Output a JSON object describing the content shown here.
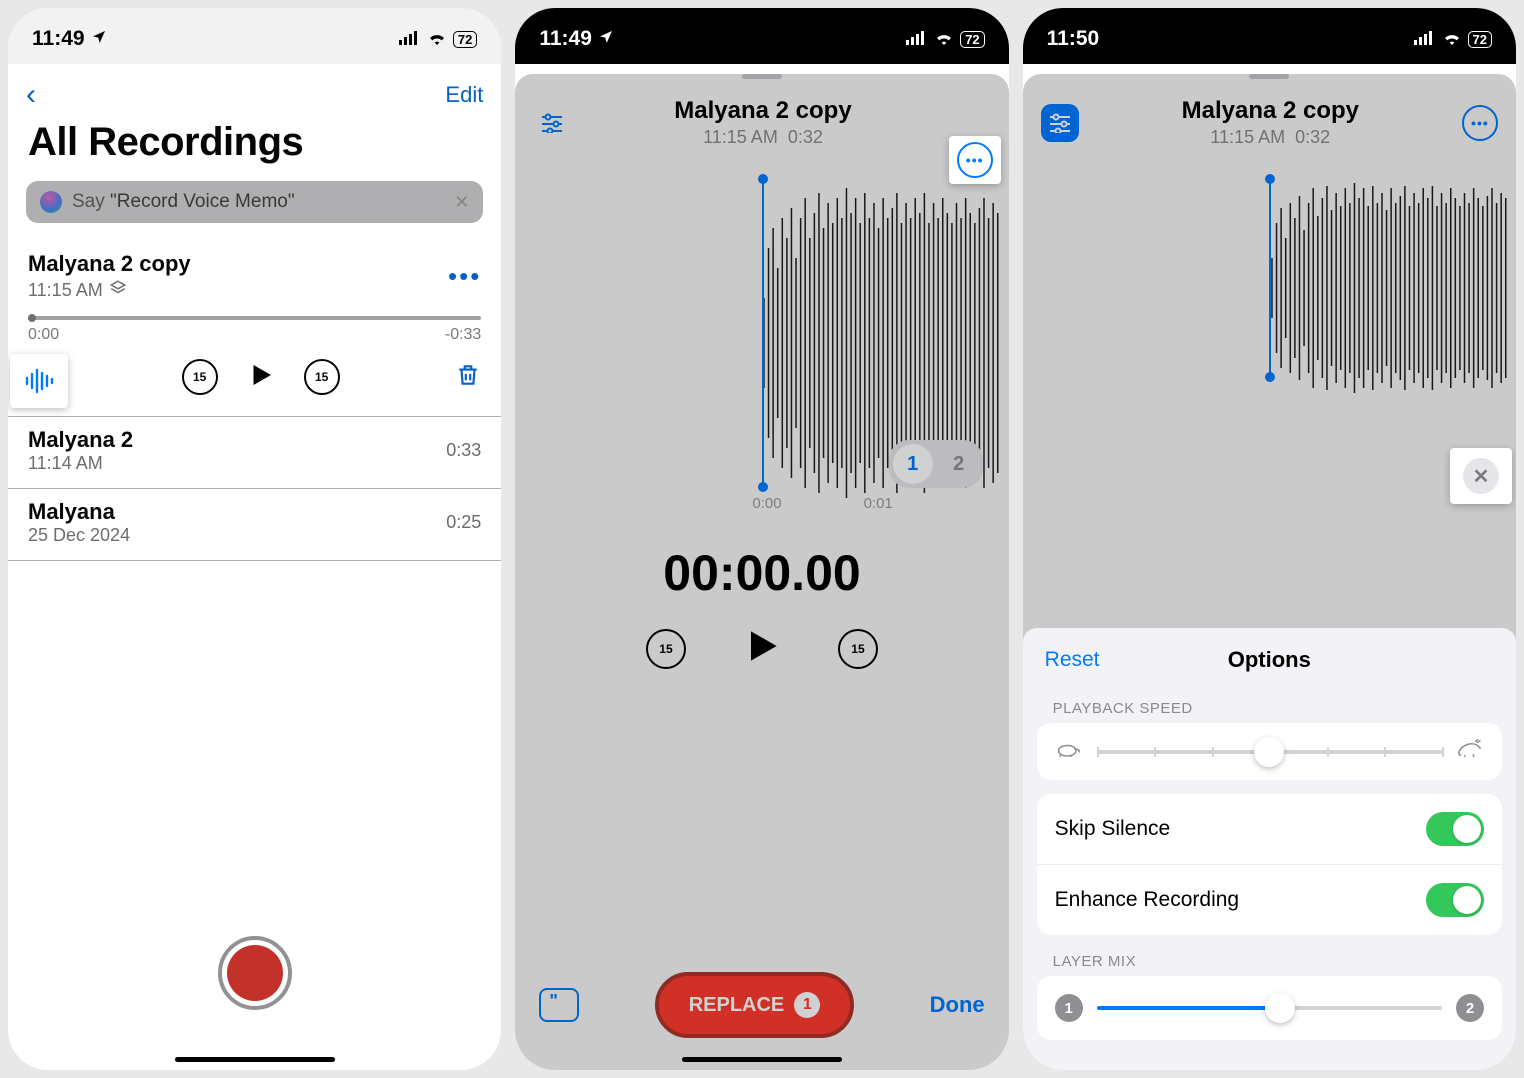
{
  "status": {
    "time1": "11:49",
    "time2": "11:49",
    "time3": "11:50",
    "battery": "72"
  },
  "screen1": {
    "edit": "Edit",
    "title": "All Recordings",
    "siri_prefix": "Say ",
    "siri_quote": "\"Record Voice Memo\"",
    "current": {
      "title": "Malyana 2 copy",
      "time": "11:15 AM",
      "pos": "0:00",
      "remain": "-0:33"
    },
    "items": [
      {
        "title": "Malyana 2",
        "sub": "11:14 AM",
        "dur": "0:33"
      },
      {
        "title": "Malyana",
        "sub": "25 Dec 2024",
        "dur": "0:25"
      }
    ],
    "skip": "15"
  },
  "editor": {
    "title": "Malyana 2 copy",
    "sub_time": "11:15 AM",
    "sub_dur": "0:32",
    "layer1": "1",
    "layer2": "2",
    "t0": "0:00",
    "t1": "0:01",
    "bigtime": "00:00.00",
    "skip": "15",
    "replace": "REPLACE",
    "replace_badge": "1",
    "done": "Done"
  },
  "options": {
    "reset": "Reset",
    "title": "Options",
    "playback_label": "PLAYBACK SPEED",
    "skip_silence": "Skip Silence",
    "enhance": "Enhance Recording",
    "layermix_label": "LAYER MIX",
    "l1": "1",
    "l2": "2"
  }
}
